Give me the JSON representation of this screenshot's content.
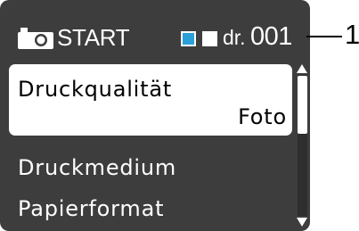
{
  "header": {
    "title": "START",
    "icon": "camera-icon",
    "ink_colors": [
      "#2a9fd8",
      "#ffffff"
    ],
    "count_prefix": "dr.",
    "count_value": "001"
  },
  "callout": {
    "label": "1"
  },
  "menu": {
    "items": [
      {
        "label": "Druckqualität",
        "value": "Foto",
        "selected": true
      },
      {
        "label": "Druckmedium"
      },
      {
        "label": "Papierformat"
      }
    ]
  },
  "scrollbar": {
    "position_fraction": 0
  },
  "colors": {
    "screen_bg": "#3d3d3d",
    "highlight_bg": "#ffffff",
    "text_light": "#ffffff",
    "accent": "#2a9fd8"
  }
}
